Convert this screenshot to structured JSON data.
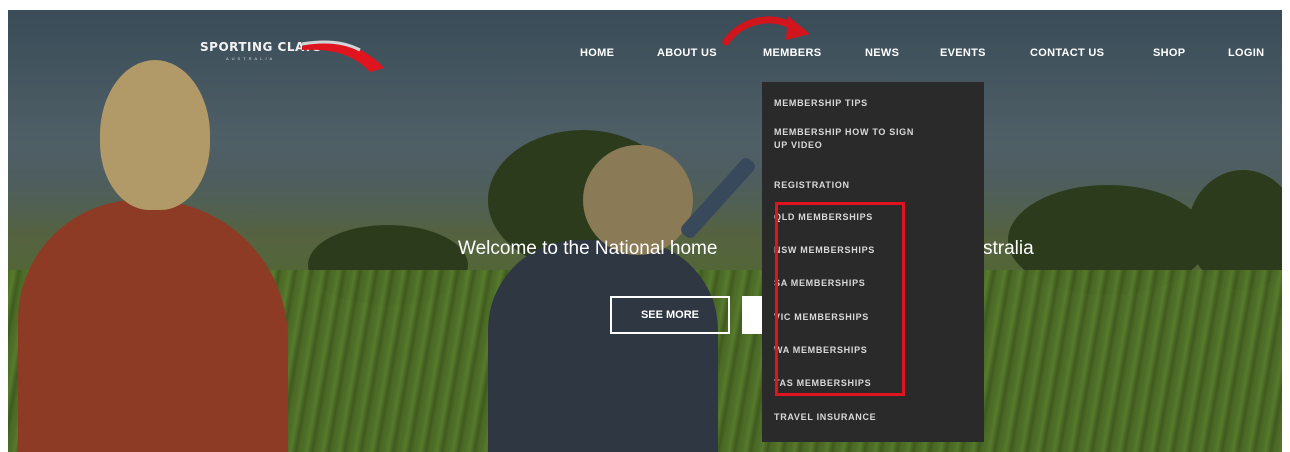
{
  "colors": {
    "accent_red": "#e0141e",
    "dropdown_bg": "#2a2a2a",
    "nav_text": "#ffffff"
  },
  "brand": {
    "logo_text": "SPORTING CLAYS",
    "logo_subtext": "AUSTRALIA"
  },
  "nav": {
    "home": "HOME",
    "about": "ABOUT US",
    "members": "MEMBERS",
    "news": "NEWS",
    "events": "EVENTS",
    "contact": "CONTACT US",
    "shop": "SHOP",
    "login": "LOGIN"
  },
  "members_menu": {
    "items": [
      "MEMBERSHIP TIPS",
      "MEMBERSHIP HOW TO SIGN",
      "UP VIDEO",
      "REGISTRATION",
      "QLD MEMBERSHIPS",
      "NSW MEMBERSHIPS",
      "SA MEMBERSHIPS",
      "VIC MEMBERSHIPS",
      "WA MEMBERSHIPS",
      "TAS MEMBERSHIPS",
      "TRAVEL INSURANCE"
    ]
  },
  "hero": {
    "welcome_left": "Welcome to the National home",
    "welcome_right": "stralia",
    "see_more": "SEE MORE"
  },
  "annotations": {
    "arrow_icon": "curved-arrow-icon",
    "highlight": "red-highlight-box"
  }
}
